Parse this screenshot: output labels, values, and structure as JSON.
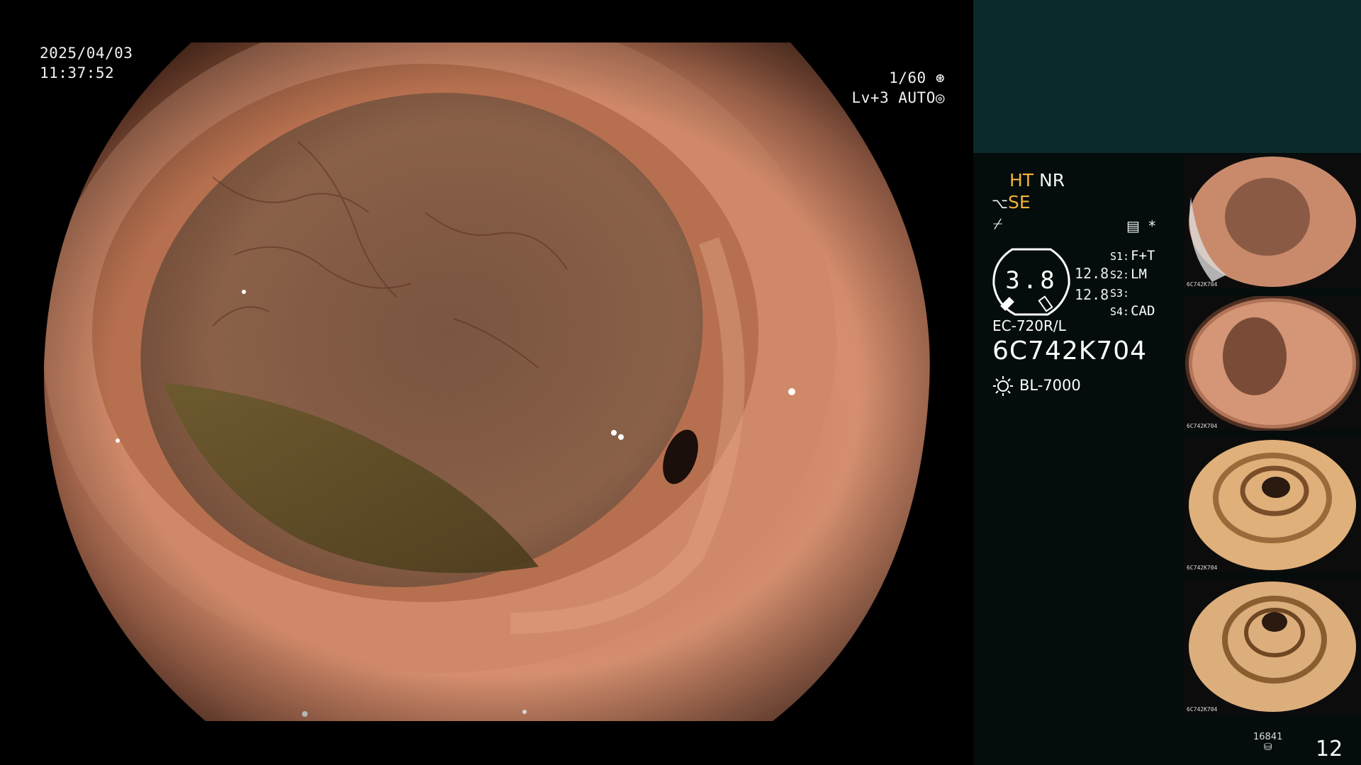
{
  "osd": {
    "date": "2025/04/03",
    "time": "11:37:52",
    "shutter": "1/60",
    "level": "Lv+3",
    "mode": "AUTO"
  },
  "status": {
    "ht": "HT",
    "nr": "NR",
    "se": "SE",
    "settings_icon": "preset-list-icon",
    "asterisk": "*"
  },
  "gauge": {
    "value": "3.8",
    "readout_1": "12.8",
    "readout_2": "12.8"
  },
  "switches": [
    {
      "key": "S1:",
      "value": "F+T"
    },
    {
      "key": "S2:",
      "value": "LM"
    },
    {
      "key": "S3:",
      "value": ""
    },
    {
      "key": "S4:",
      "value": "CAD"
    }
  ],
  "scope": {
    "model": "EC-720R/L",
    "serial": "6C742K704"
  },
  "light_source": "BL-7000",
  "thumbnails": [
    {
      "tag": "6C742K704"
    },
    {
      "tag": "6C742K704"
    },
    {
      "tag": "6C742K704"
    },
    {
      "tag": "6C742K704"
    }
  ],
  "counter": {
    "images": "16841",
    "count": "12"
  },
  "colors": {
    "mucosa": "#c47a5c",
    "lumen": "#6b4a36",
    "fluid": "#5a4a22",
    "panel_top": "#0b2a2a",
    "panel": "#040c0c",
    "accent_yellow": "#f2b23a"
  }
}
